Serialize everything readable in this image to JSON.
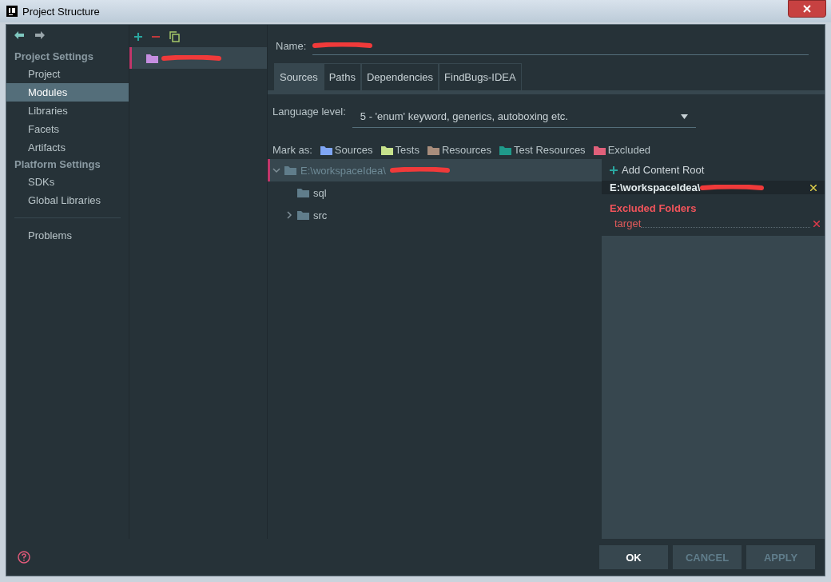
{
  "window": {
    "title": "Project Structure"
  },
  "sidebar": {
    "sections": [
      {
        "title": "Project Settings",
        "items": [
          {
            "label": "Project",
            "selected": false
          },
          {
            "label": "Modules",
            "selected": true
          },
          {
            "label": "Libraries",
            "selected": false
          },
          {
            "label": "Facets",
            "selected": false
          },
          {
            "label": "Artifacts",
            "selected": false
          }
        ]
      },
      {
        "title": "Platform Settings",
        "items": [
          {
            "label": "SDKs",
            "selected": false
          },
          {
            "label": "Global Libraries",
            "selected": false
          }
        ]
      }
    ],
    "extra_items": [
      {
        "label": "Problems",
        "selected": false
      }
    ]
  },
  "modules": [
    {
      "selected": true
    }
  ],
  "name_field": {
    "label": "Name:"
  },
  "tabs": [
    {
      "label": "Sources",
      "selected": true
    },
    {
      "label": "Paths",
      "selected": false
    },
    {
      "label": "Dependencies",
      "selected": false
    },
    {
      "label": "FindBugs-IDEA",
      "selected": false
    }
  ],
  "language_level": {
    "label": "Language level:",
    "value": "5 - 'enum' keyword, generics, autoboxing etc."
  },
  "mark_as": {
    "label": "Mark as:",
    "items": [
      {
        "label": "Sources",
        "color": "#7fa6f5"
      },
      {
        "label": "Tests",
        "color": "#c7e28c"
      },
      {
        "label": "Resources",
        "color": "#a88d7c"
      },
      {
        "label": "Test Resources",
        "color": "#1f9a8a"
      },
      {
        "label": "Excluded",
        "color": "#e0607a"
      }
    ]
  },
  "tree": [
    {
      "label": "E:\\workspaceIdea\\",
      "expandable": true,
      "expanded": true,
      "selected": true,
      "children": [
        {
          "label": "sql",
          "expandable": false,
          "expanded": false,
          "selected": false
        },
        {
          "label": "src",
          "expandable": true,
          "expanded": false,
          "selected": false
        }
      ]
    }
  ],
  "content_root": {
    "add_label": "Add Content Root",
    "path": "E:\\workspaceIdea\\",
    "excluded_title": "Excluded Folders",
    "excluded": [
      "target"
    ]
  },
  "buttons": [
    {
      "label": "OK",
      "disabled": false
    },
    {
      "label": "CANCEL",
      "disabled": true
    },
    {
      "label": "APPLY",
      "disabled": true
    }
  ]
}
